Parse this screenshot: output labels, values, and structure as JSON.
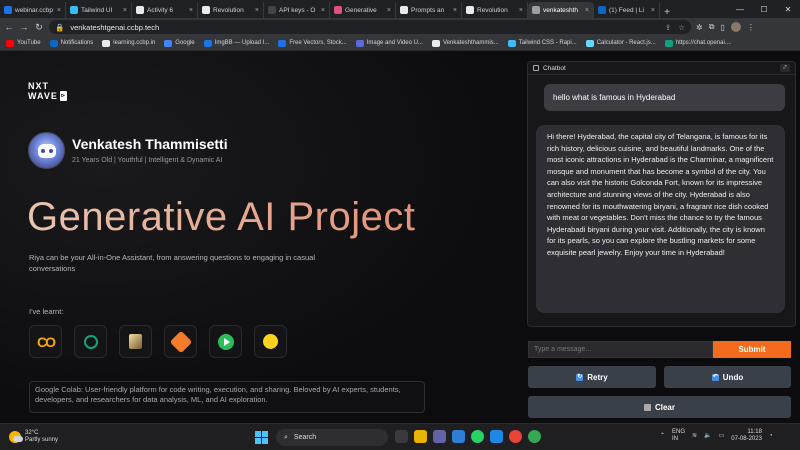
{
  "browser": {
    "tabs": [
      {
        "title": "webinar.ccbp",
        "color": "#1a73e8"
      },
      {
        "title": "Tailwind UI",
        "color": "#38bdf8"
      },
      {
        "title": "Activity 6",
        "color": "#e8eaed"
      },
      {
        "title": "Revolution",
        "color": "#e8eaed"
      },
      {
        "title": "API keys - O",
        "color": "#444"
      },
      {
        "title": "Generative",
        "color": "#e0507a"
      },
      {
        "title": "Prompts an",
        "color": "#e8eaed"
      },
      {
        "title": "Revolution",
        "color": "#e8eaed"
      },
      {
        "title": "venkateshth",
        "color": "#9aa0a6"
      },
      {
        "title": "(1) Feed | Li",
        "color": "#0a66c2"
      }
    ],
    "url": "venkateshtgenai.ccbp.tech",
    "bookmarks": [
      {
        "label": "YouTube",
        "color": "#ff0000"
      },
      {
        "label": "Notifications",
        "color": "#0a66c2"
      },
      {
        "label": "learning.ccbp.in",
        "color": "#e8eaed"
      },
      {
        "label": "Google",
        "color": "#4285f4"
      },
      {
        "label": "ImgBB — Upload I...",
        "color": "#1a73e8"
      },
      {
        "label": "Free Vectors, Stock...",
        "color": "#1a73e8"
      },
      {
        "label": "Image and Video U...",
        "color": "#5b6bdc"
      },
      {
        "label": "Venkateshthammis...",
        "color": "#e8eaed"
      },
      {
        "label": "Tailwind CSS - Rapi...",
        "color": "#38bdf8"
      },
      {
        "label": "Calculator - React.js...",
        "color": "#61dafb"
      },
      {
        "label": "https://chat.openai....",
        "color": "#10a37f"
      }
    ]
  },
  "logo": {
    "line1": "NXT",
    "line2": "WAVE"
  },
  "profile": {
    "name": "Venkatesh Thammisetti",
    "subtitle": "21 Years Old | Youthful | Intelligent & Dynamic AI"
  },
  "hero": {
    "title": "Generative AI Project"
  },
  "description": "Riya can be your All-in-One Assistant, from answering questions to engaging in casual conversations",
  "learnt_label": "I've learnt:",
  "skills": [
    "colab-icon",
    "openai-icon",
    "prompt-icon",
    "stack-icon",
    "play-icon",
    "huggingface-icon"
  ],
  "skill_info": "Google Colab: User-friendly platform for code writing, execution, and sharing. Beloved by AI experts, students, developers, and researchers for data analysis, ML, and AI exploration.",
  "chatbot": {
    "header": "Chatbot",
    "user_message": "hello what is famous in Hyderabad",
    "bot_message": "Hi there! Hyderabad, the capital city of Telangana, is famous for its rich history, delicious cuisine, and beautiful landmarks. One of the most iconic attractions in Hyderabad is the Charminar, a magnificent mosque and monument that has become a symbol of the city. You can also visit the historic Golconda Fort, known for its impressive architecture and stunning views of the city. Hyderabad is also renowned for its mouthwatering biryani, a fragrant rice dish cooked with meat or vegetables. Don't miss the chance to try the famous Hyderabadi biryani during your visit. Additionally, the city is known for its pearls, so you can explore the bustling markets for some exquisite pearl jewelry. Enjoy your time in Hyderabad!",
    "input_placeholder": "Type a message...",
    "submit_label": "Submit",
    "retry_label": "Retry",
    "undo_label": "Undo",
    "clear_label": "Clear"
  },
  "taskbar": {
    "temp": "32°C",
    "weather": "Partly sunny",
    "search_label": "Search",
    "lang1": "ENG",
    "lang2": "IN",
    "time": "11:18",
    "date": "07-08-2023"
  }
}
